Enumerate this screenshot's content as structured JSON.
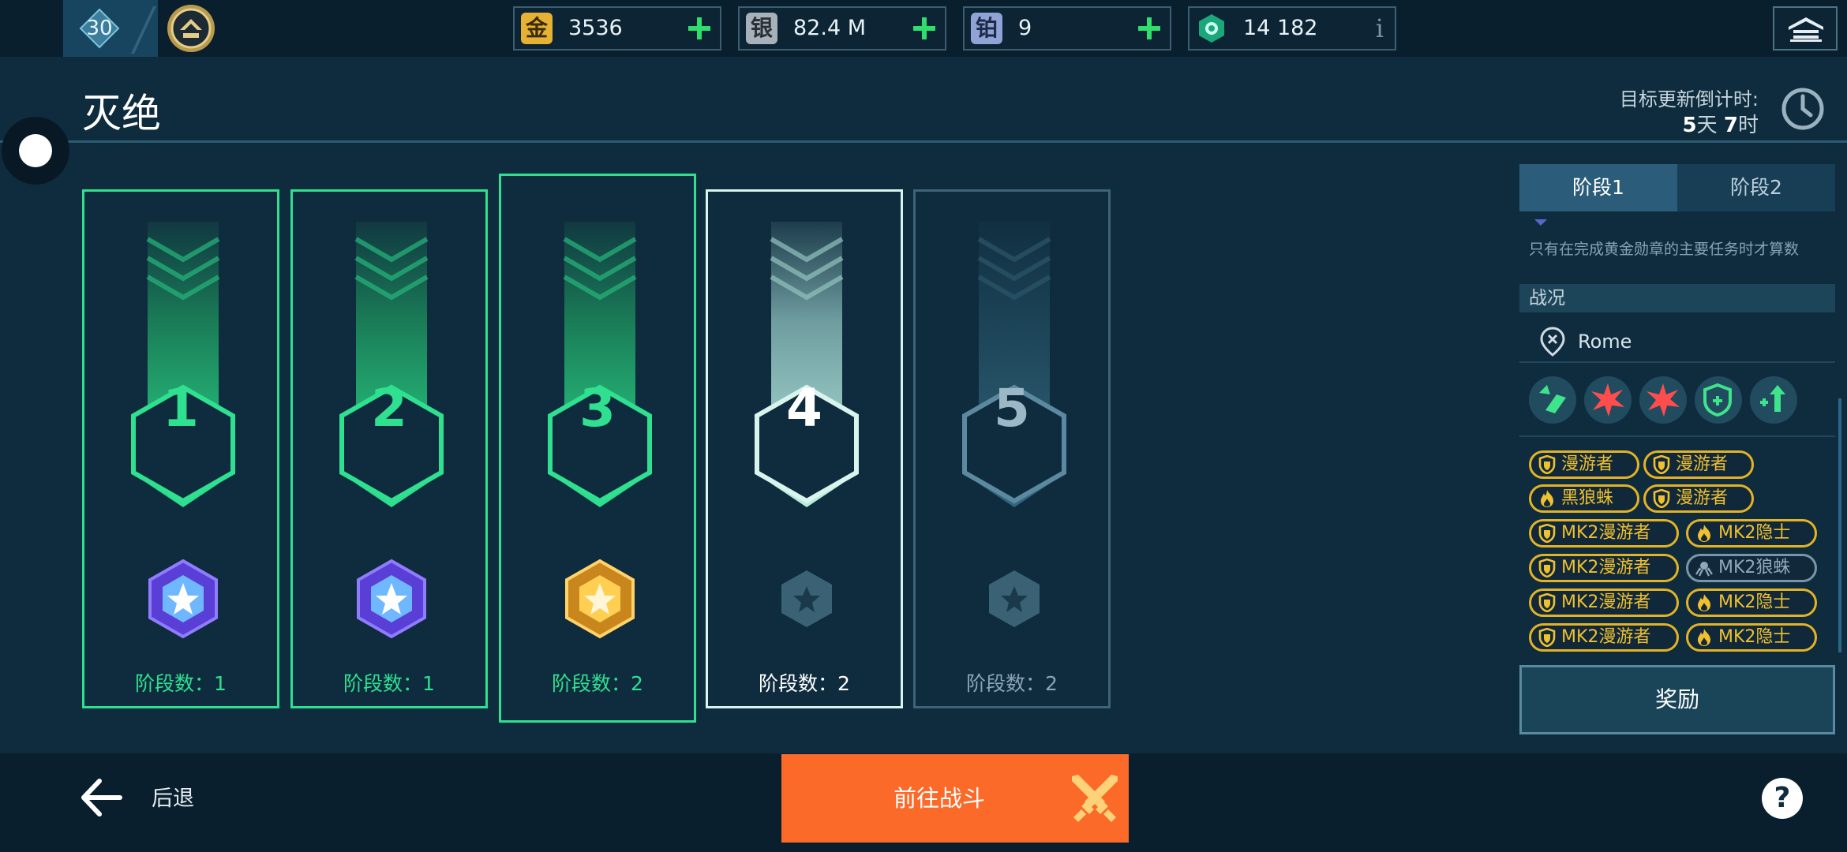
{
  "player": {
    "level": "30"
  },
  "resources": [
    {
      "name": "gold",
      "glyph": "金",
      "value": "3536",
      "color": "#e6b233"
    },
    {
      "name": "silver",
      "glyph": "银",
      "value": "82.4 M",
      "color": "#a7b1b9"
    },
    {
      "name": "platinum",
      "glyph": "铂",
      "value": "9",
      "color": "#8fa3d6"
    },
    {
      "name": "key",
      "value": "14 182",
      "color": "#2ee0a0"
    }
  ],
  "header": {
    "title": "灭绝",
    "timer_label": "目标更新倒计时:",
    "timer_days": "5",
    "timer_days_unit": "天",
    "timer_hours": "7",
    "timer_hours_unit": "时"
  },
  "stages": [
    {
      "number": "1",
      "label": "阶段数：1",
      "state": "completed",
      "medal": "purple"
    },
    {
      "number": "2",
      "label": "阶段数：1",
      "state": "completed",
      "medal": "purple"
    },
    {
      "number": "3",
      "label": "阶段数：2",
      "state": "completed",
      "medal": "gold"
    },
    {
      "number": "4",
      "label": "阶段数：2",
      "state": "current",
      "medal": "locked"
    },
    {
      "number": "5",
      "label": "阶段数：2",
      "state": "locked",
      "medal": "locked"
    }
  ],
  "panel": {
    "tabs": [
      {
        "label": "阶段1"
      },
      {
        "label": "阶段2"
      }
    ],
    "note": "只有在完成黄金勋章的主要任务时才算数",
    "section_title": "战况",
    "location": "Rome",
    "enemies": [
      {
        "label": "漫游者",
        "icon": "shield",
        "tone": "gold"
      },
      {
        "label": "漫游者",
        "icon": "shield",
        "tone": "gold"
      },
      {
        "label": "黑狼蛛",
        "icon": "flame",
        "tone": "gold"
      },
      {
        "label": "漫游者",
        "icon": "shield",
        "tone": "gold"
      },
      {
        "label": "MK2漫游者",
        "icon": "shield",
        "tone": "gold"
      },
      {
        "label": "MK2隐士",
        "icon": "flame",
        "tone": "gold"
      },
      {
        "label": "MK2漫游者",
        "icon": "shield",
        "tone": "gold"
      },
      {
        "label": "MK2狼蛛",
        "icon": "spider",
        "tone": "gray"
      },
      {
        "label": "MK2漫游者",
        "icon": "shield",
        "tone": "gold"
      },
      {
        "label": "MK2隐士",
        "icon": "flame",
        "tone": "gold"
      },
      {
        "label": "MK2漫游者",
        "icon": "shield",
        "tone": "gold"
      },
      {
        "label": "MK2隐士",
        "icon": "flame",
        "tone": "gold"
      }
    ],
    "reward_label": "奖励"
  },
  "footer": {
    "back_label": "后退",
    "battle_label": "前往战斗"
  }
}
